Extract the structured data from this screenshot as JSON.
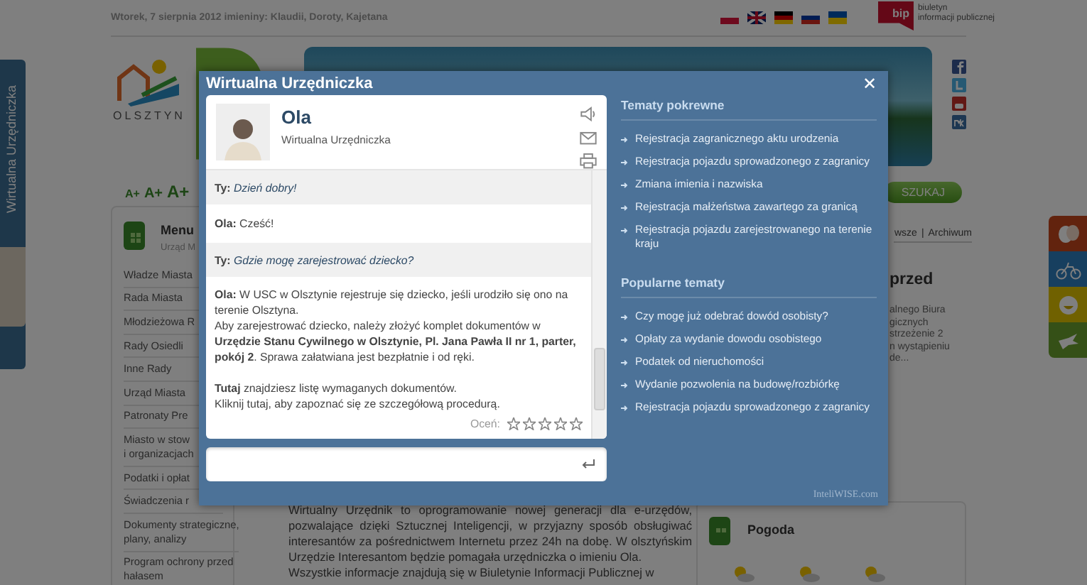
{
  "header": {
    "date": "Wtorek, 7 sierpnia 2012 imieniny: Klaudii, Doroty, Kajetana",
    "bip_mark": "bip",
    "bip_caption": "biuletyn\ninformacji publicznej"
  },
  "side_tab": {
    "label": "Wirtualna Urzędniczka"
  },
  "logo": {
    "text": "OLSZTYN"
  },
  "font_size_buttons": [
    "A+",
    "A+",
    "A+"
  ],
  "search_button": "SZUKAJ",
  "menu": {
    "title": "Menu",
    "subtitle": "Urząd M",
    "items": [
      "Władze Miasta",
      "Rada Miasta",
      "Młodzieżowa R",
      "Rady Osiedli",
      "Inne Rady",
      "Urząd Miasta",
      "Patronaty Pre",
      "Miasto w stow\ni organizacjach",
      "Podatki i opłat",
      "Świadczenia r",
      "Dokumenty strategiczne,\nplany, analizy",
      "Program ochrony przed\nhałasem"
    ]
  },
  "news": {
    "links": [
      "wsze",
      "Archiwum"
    ],
    "separator": "|",
    "headline": "przed",
    "snippet": "alnego Biura\ngicznych\nstrzeżenie 2\nn wystąpieniu\nde..."
  },
  "article": {
    "paragraphs": [
      "Wirtualny Urzędnik to oprogramowanie nowej generacji dla e-urzędów, pozwalające dzięki Sztucznej Inteligencji, w przyjazny sposób obsługiwać interesantów za pośrednictwem Internetu przez 24h na dobę. W olsztyńskim Urzędzie Interesantom będzie pomagała urzędniczka o imieniu Ola.",
      "Wszystkie informacje znajdują się w Biuletynie Informacji Publicznej w"
    ]
  },
  "weather": {
    "title": "Pogoda"
  },
  "modal": {
    "title": "Wirtualna Urzędniczka",
    "close": "✕",
    "agent": {
      "name": "Ola",
      "role": "Wirtualna Urzędniczka"
    },
    "messages": [
      {
        "kind": "user",
        "paragraphs": [
          "**Ty:** *Dzień dobry!*"
        ]
      },
      {
        "kind": "bot",
        "paragraphs": [
          "**Ola:** Cześć!"
        ]
      },
      {
        "kind": "user",
        "paragraphs": [
          "**Ty:** *Gdzie mogę zarejestrować dziecko?*"
        ]
      },
      {
        "kind": "bot",
        "paragraphs": [
          "**Ola:** W USC w Olsztynie rejestruje się dziecko, jeśli urodziło się ono na terenie Olsztyna.\nAby zarejestrować dziecko, należy złożyć komplet dokumentów w **Urzędzie Stanu Cywilnego w Olsztynie, Pl. Jana Pawła II nr 1, parter, pokój 2**. Sprawa załatwiana jest bezpłatnie i od ręki.",
          "**Tutaj** znajdziesz listę wymaganych dokumentów.\nKliknij tutaj, aby zapoznać się ze szczegółową procedurą."
        ]
      }
    ],
    "rating": {
      "label": "Oceń:",
      "stars": 0
    },
    "related": {
      "title": "Tematy pokrewne",
      "items": [
        "Rejestracja zagranicznego aktu urodzenia",
        "Rejestracja pojazdu sprowadzonego z zagranicy",
        "Zmiana imienia i nazwiska",
        "Rejestracja małżeństwa zawartego za granicą",
        "Rejestracja pojazdu zarejestrowanego na terenie kraju"
      ]
    },
    "popular": {
      "title": "Popularne tematy",
      "items": [
        "Czy mogę już odebrać dowód osobisty?",
        "Opłaty za wydanie dowodu osobistego",
        "Podatek od nieruchomości",
        "Wydanie pozwolenia na budowę/rozbiórkę",
        "Rejestracja pojazdu sprowadzonego z zagranicy"
      ]
    },
    "powered_by": "InteliWISE.com"
  }
}
